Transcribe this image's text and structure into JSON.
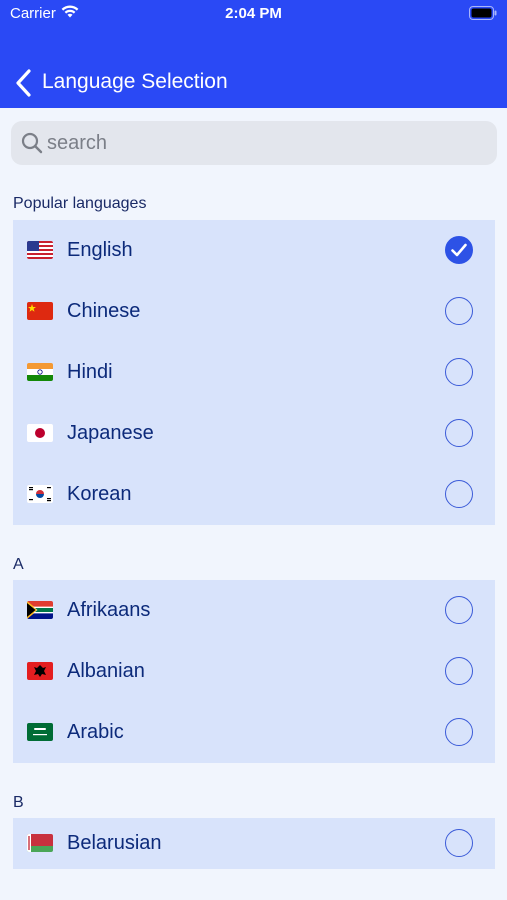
{
  "status_bar": {
    "carrier": "Carrier",
    "time": "2:04 PM"
  },
  "nav": {
    "title": "Language Selection"
  },
  "search": {
    "placeholder": "search",
    "value": ""
  },
  "colors": {
    "header": "#2a49f5",
    "row_background": "#d8e3fb",
    "accent": "#2d52e6"
  },
  "sections": [
    {
      "title": "Popular languages",
      "items": [
        {
          "label": "English",
          "flag": "us-flag-icon",
          "selected": true
        },
        {
          "label": "Chinese",
          "flag": "cn-flag-icon",
          "selected": false
        },
        {
          "label": "Hindi",
          "flag": "in-flag-icon",
          "selected": false
        },
        {
          "label": "Japanese",
          "flag": "jp-flag-icon",
          "selected": false
        },
        {
          "label": "Korean",
          "flag": "kr-flag-icon",
          "selected": false
        }
      ]
    },
    {
      "title": "A",
      "items": [
        {
          "label": "Afrikaans",
          "flag": "za-flag-icon",
          "selected": false
        },
        {
          "label": "Albanian",
          "flag": "al-flag-icon",
          "selected": false
        },
        {
          "label": "Arabic",
          "flag": "sa-flag-icon",
          "selected": false
        }
      ]
    },
    {
      "title": "B",
      "items": [
        {
          "label": "Belarusian",
          "flag": "by-flag-icon",
          "selected": false
        }
      ]
    }
  ]
}
